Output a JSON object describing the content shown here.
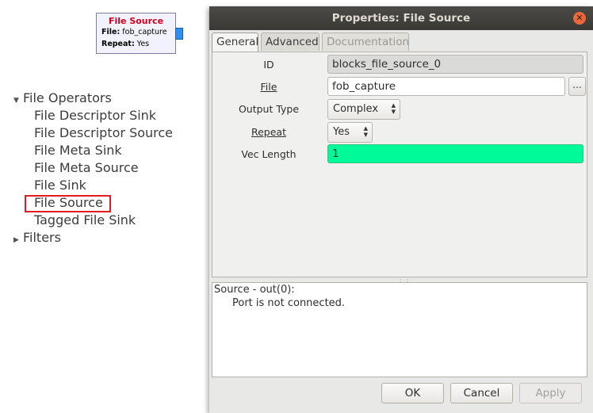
{
  "flowgraph_block": {
    "title": "File Source",
    "file_label": "File:",
    "file_value": "fob_capture",
    "repeat_label": "Repeat:",
    "repeat_value": "Yes"
  },
  "block_tree": {
    "category": "File Operators",
    "items": [
      "File Descriptor Sink",
      "File Descriptor Source",
      "File Meta Sink",
      "File Meta Source",
      "File Sink",
      "File Source",
      "Tagged File Sink"
    ],
    "collapsed_category": "Filters",
    "highlighted_item": "File Source"
  },
  "dialog": {
    "title": "Properties: File Source",
    "tabs": [
      {
        "label": "General",
        "state": "active"
      },
      {
        "label": "Advanced",
        "state": "normal"
      },
      {
        "label": "Documentation",
        "state": "disabled"
      }
    ],
    "params": {
      "id_label": "ID",
      "id_value": "blocks_file_source_0",
      "file_label": "File",
      "file_value": "fob_capture",
      "browse_label": "...",
      "output_type_label": "Output Type",
      "output_type_value": "Complex",
      "repeat_label": "Repeat",
      "repeat_value": "Yes",
      "vec_length_label": "Vec Length",
      "vec_length_value": "1"
    },
    "messages": {
      "line1": "Source - out(0):",
      "line2": "Port is not connected."
    },
    "buttons": {
      "ok": "OK",
      "cancel": "Cancel",
      "apply": "Apply"
    }
  },
  "colors": {
    "titlebar": "#3d3c38",
    "highlight_border": "#e31b23",
    "vec_length_field": "#00fa9a",
    "block_title": "#d0021b",
    "port": "#2f8ff0"
  }
}
